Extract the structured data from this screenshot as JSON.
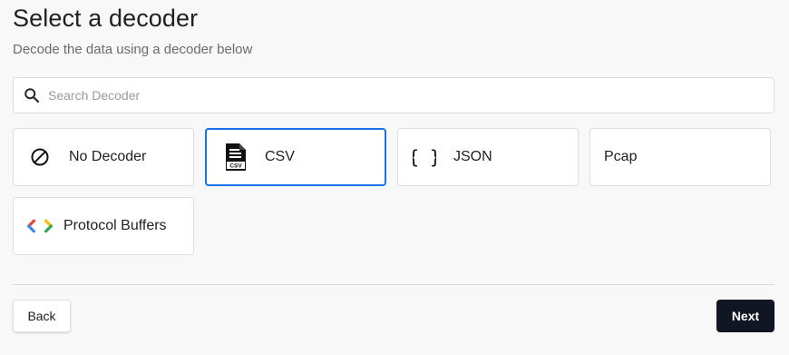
{
  "header": {
    "title": "Select a decoder",
    "subtitle": "Decode the data using a decoder below"
  },
  "search": {
    "placeholder": "Search Decoder",
    "value": ""
  },
  "decoders": [
    {
      "label": "No Decoder",
      "icon": "no-decoder-icon",
      "selected": false
    },
    {
      "label": "CSV",
      "icon": "csv-file-icon",
      "selected": true
    },
    {
      "label": "JSON",
      "icon": "curly-braces-icon",
      "selected": false
    },
    {
      "label": "Pcap",
      "icon": "",
      "selected": false
    },
    {
      "label": "Protocol Buffers",
      "icon": "protobuf-chevrons-icon",
      "selected": false
    }
  ],
  "footer": {
    "back_label": "Back",
    "next_label": "Next"
  },
  "colors": {
    "accent": "#1a73e8",
    "next_button": "#111722",
    "protobuf_red": "#ea4335",
    "protobuf_blue": "#4285f4",
    "protobuf_yellow": "#fbbc04",
    "protobuf_green": "#34a853"
  }
}
